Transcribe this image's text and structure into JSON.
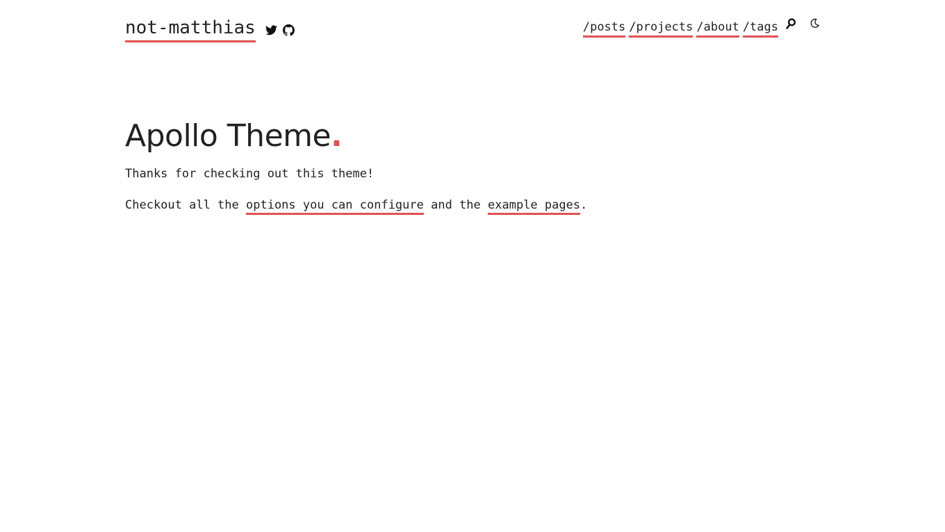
{
  "header": {
    "site_title": "not-matthias",
    "social": [
      {
        "name": "twitter-icon"
      },
      {
        "name": "github-icon"
      }
    ],
    "nav": [
      {
        "label": "/posts"
      },
      {
        "label": "/projects"
      },
      {
        "label": "/about"
      },
      {
        "label": "/tags"
      }
    ],
    "search_icon": "search-icon",
    "theme_toggle_icon": "moon-icon"
  },
  "main": {
    "title": "Apollo Theme",
    "title_dot": ".",
    "paragraph1": "Thanks for checking out this theme!",
    "paragraph2": {
      "prefix": "Checkout all the ",
      "link1": "options you can configure",
      "middle": " and the ",
      "link2": "example pages",
      "suffix": "."
    }
  },
  "colors": {
    "accent": "#e05252",
    "text": "#222222",
    "background": "#ffffff"
  }
}
